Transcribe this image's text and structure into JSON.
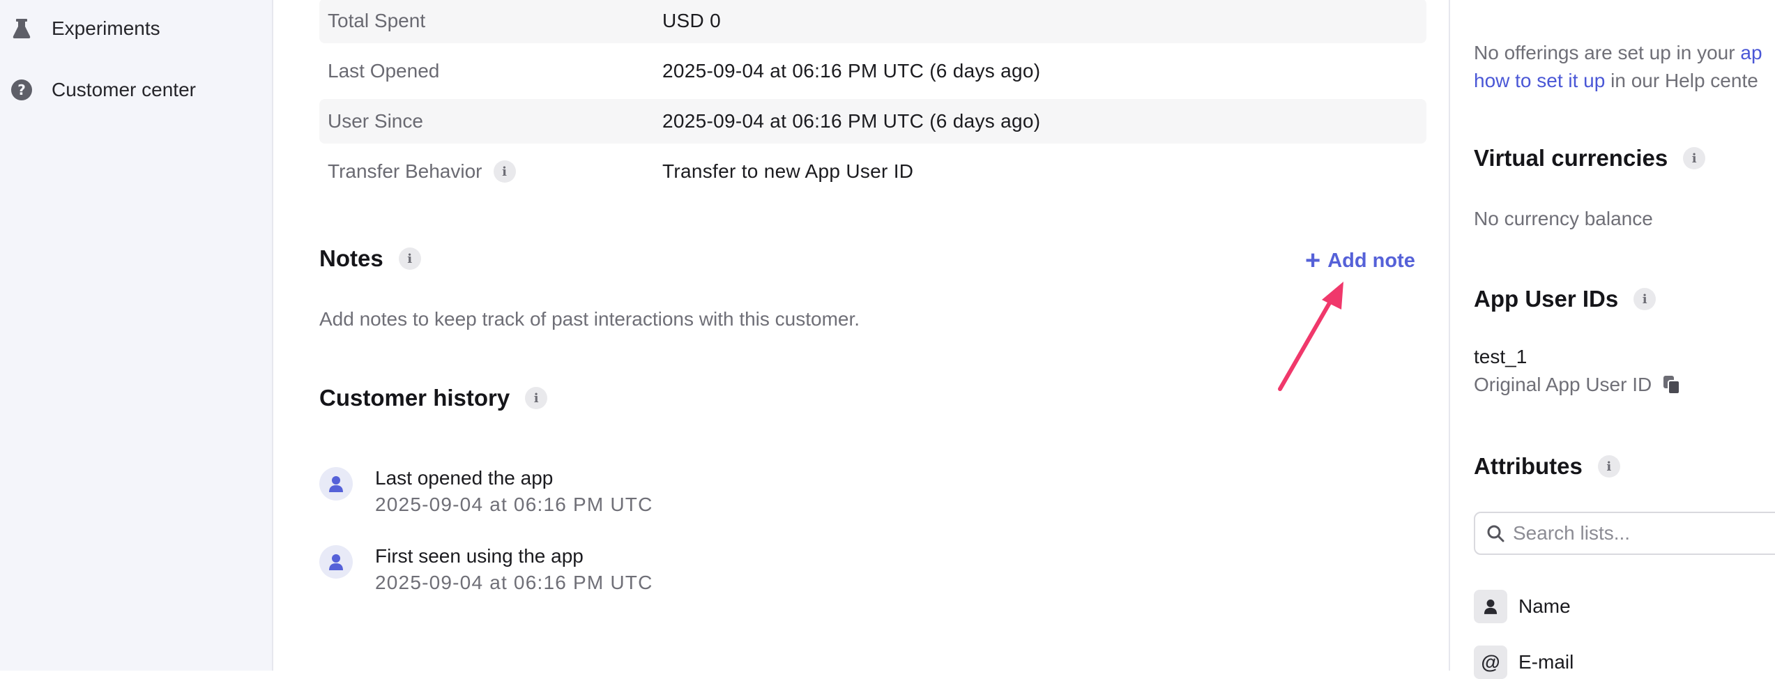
{
  "sidebar": {
    "items": [
      {
        "label": "Experiments",
        "icon": "flask-icon"
      },
      {
        "label": "Customer center",
        "icon": "question-circle-icon"
      }
    ]
  },
  "details": {
    "rows": [
      {
        "label": "Total Spent",
        "value": "USD 0"
      },
      {
        "label": "Last Opened",
        "value": "2025-09-04 at 06:16 PM UTC (6 days ago)"
      },
      {
        "label": "User Since",
        "value": "2025-09-04 at 06:16 PM UTC (6 days ago)"
      },
      {
        "label": "Transfer Behavior",
        "value": "Transfer to new App User ID"
      }
    ]
  },
  "notes": {
    "title": "Notes",
    "add_label": "Add note",
    "empty_text": "Add notes to keep track of past interactions with this customer."
  },
  "history": {
    "title": "Customer history",
    "events": [
      {
        "title": "Last opened the app",
        "time": "2025-09-04 at 06:16 PM UTC"
      },
      {
        "title": "First seen using the app",
        "time": "2025-09-04 at 06:16 PM UTC"
      }
    ]
  },
  "right_panel": {
    "offerings_text_1": "No offerings are set up in your ",
    "offerings_link_1": "ap",
    "offerings_link_2": "how to set it up",
    "offerings_text_2": " in our Help cente",
    "virtual_currencies": {
      "title": "Virtual currencies",
      "empty": "No currency balance"
    },
    "app_user_ids": {
      "title": "App User IDs",
      "id": "test_1",
      "id_caption": "Original App User ID"
    },
    "attributes": {
      "title": "Attributes",
      "search_placeholder": "Search lists...",
      "items": [
        {
          "label": "Name",
          "icon": "person-icon"
        },
        {
          "label": "E-mail",
          "icon": "at-sign-icon"
        }
      ]
    }
  },
  "annotation": {
    "color": "#f0386b",
    "points_to": "Add note"
  },
  "colors": {
    "accent": "#5561d8",
    "sidebar_bg": "#f4f5fa",
    "row_shade": "#f6f6f7"
  }
}
